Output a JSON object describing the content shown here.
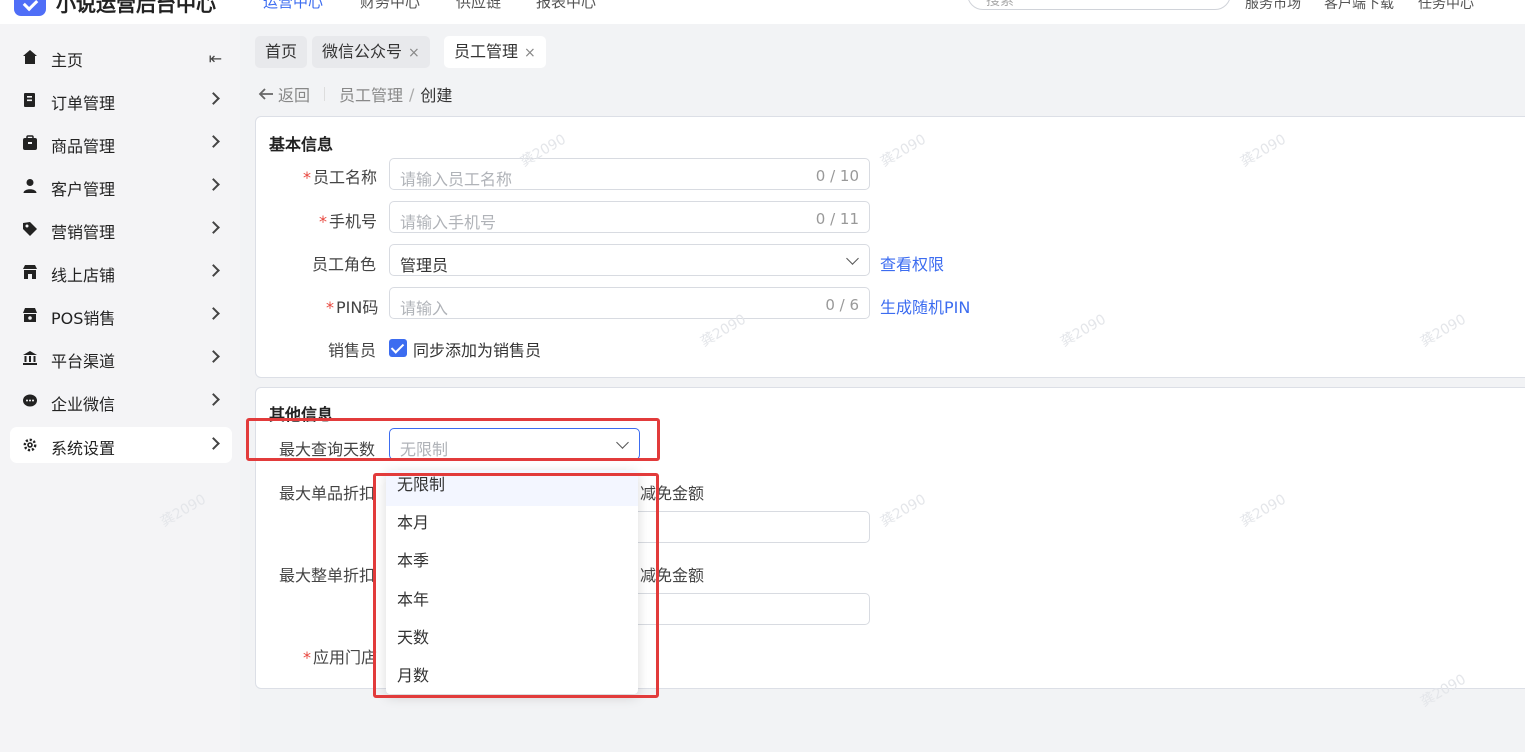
{
  "header": {
    "app_title": "小说运营后台中心",
    "nav": [
      "运营中心",
      "财务中心",
      "供应链",
      "报表中心"
    ],
    "search_placeholder": "搜索",
    "links": [
      "服务市场",
      "客户端下载",
      "任务中心"
    ]
  },
  "sidebar": {
    "items": [
      {
        "label": "主页",
        "icon": "home-icon"
      },
      {
        "label": "订单管理",
        "icon": "order-icon"
      },
      {
        "label": "商品管理",
        "icon": "goods-icon"
      },
      {
        "label": "客户管理",
        "icon": "user-icon"
      },
      {
        "label": "营销管理",
        "icon": "tag-icon"
      },
      {
        "label": "线上店铺",
        "icon": "store-icon"
      },
      {
        "label": "POS销售",
        "icon": "pos-icon"
      },
      {
        "label": "平台渠道",
        "icon": "bank-icon"
      },
      {
        "label": "企业微信",
        "icon": "chat-icon"
      },
      {
        "label": "系统设置",
        "icon": "gear-icon"
      }
    ]
  },
  "tabs": [
    {
      "label": "首页"
    },
    {
      "label": "微信公众号",
      "close": "×"
    },
    {
      "label": "员工管理",
      "close": "×"
    }
  ],
  "breadcrumb": {
    "back": "返回",
    "parent": "员工管理",
    "slash": "/",
    "current": "创建"
  },
  "basic": {
    "title": "基本信息",
    "req_mark": "*",
    "name_label": "员工名称",
    "name_placeholder": "请输入员工名称",
    "name_count": "0 / 10",
    "phone_label": "手机号",
    "phone_placeholder": "请输入手机号",
    "phone_count": "0 / 11",
    "role_label": "员工角色",
    "role_value": "管理员",
    "view_perm": "查看权限",
    "pin_label": "PIN码",
    "pin_placeholder": "请输入",
    "pin_count": "0 / 6",
    "gen_pin": "生成随机PIN",
    "sales_label": "销售员",
    "sales_checkbox": "同步添加为销售员"
  },
  "other": {
    "title": "其他信息",
    "max_days_label": "最大查询天数",
    "max_days_placeholder": "无限制",
    "single_discount_label": "最大单品折扣",
    "single_suffix": "减免金额",
    "order_discount_label": "最大整单折扣",
    "order_suffix": "减免金额",
    "store_label": "应用门店"
  },
  "dropdown": {
    "options": [
      "无限制",
      "本月",
      "本季",
      "本年",
      "天数",
      "月数"
    ]
  },
  "watermark": "龚2090",
  "colors": {
    "accent": "#3c6cf0",
    "highlight": "#e23b3b",
    "required": "#e8453c"
  }
}
